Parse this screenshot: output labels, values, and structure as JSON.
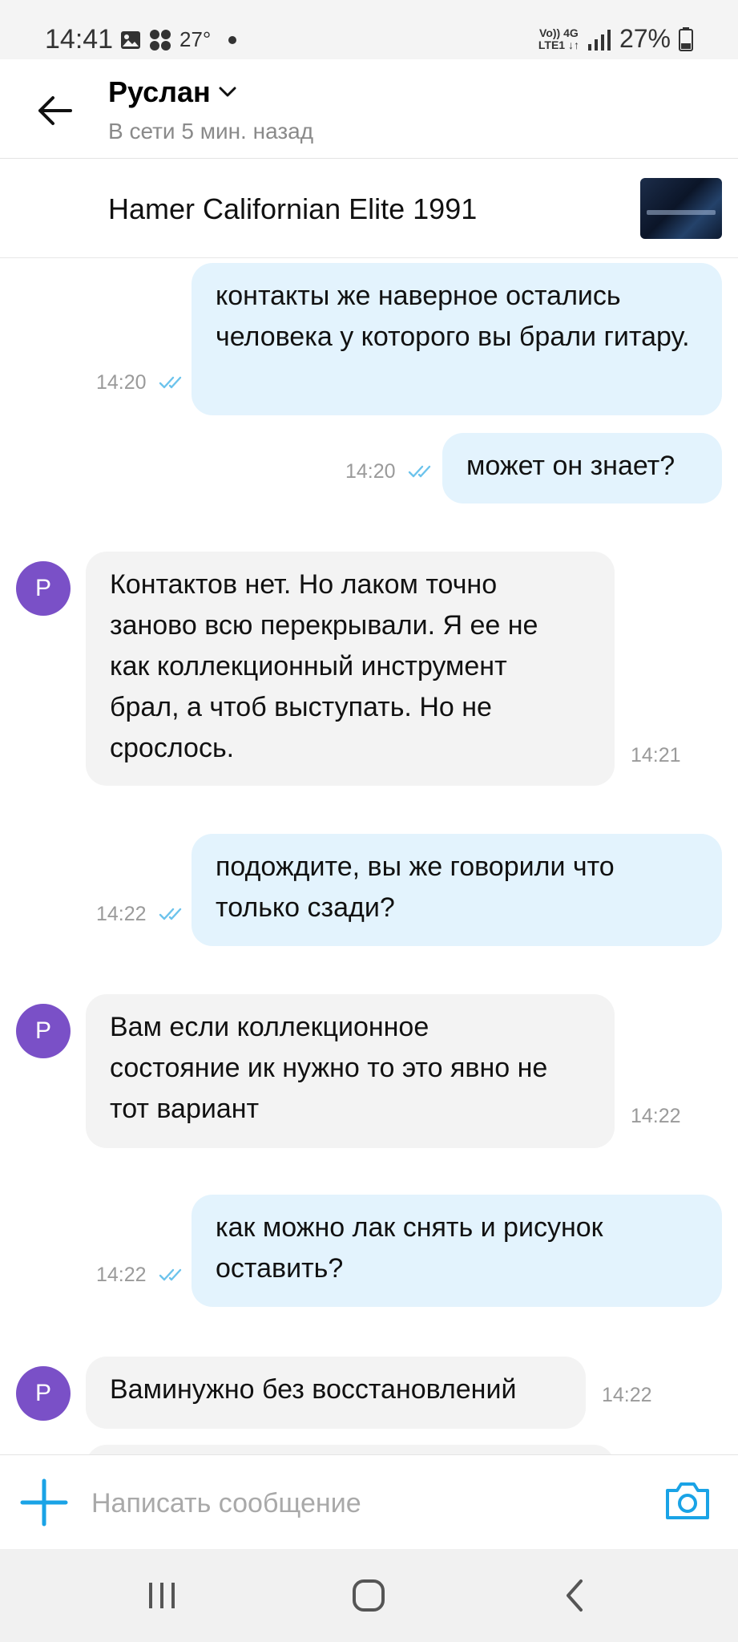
{
  "status_bar": {
    "time": "14:41",
    "temperature": "27°",
    "network_top": "Vo)) 4G",
    "network_bottom": "LTE1 ↓↑",
    "battery": "27%"
  },
  "header": {
    "contact_name": "Руслан",
    "status": "В сети 5 мин. назад"
  },
  "listing": {
    "title": "Hamer Californian Elite 1991"
  },
  "messages": [
    {
      "direction": "out",
      "text": "контакты же наверное остались человека у которого вы брали гитару.",
      "time": "14:20",
      "read": true
    },
    {
      "direction": "out",
      "text": "может он знает?",
      "time": "14:20",
      "read": true
    },
    {
      "direction": "in",
      "avatar_letter": "Р",
      "text": "Контактов нет. Но лаком точно заново всю перекрывали. Я ее не как коллекционный инструмент брал, а чтоб выступать. Но не срослось.",
      "time": "14:21"
    },
    {
      "direction": "out",
      "text": "подождите, вы же говорили что только сзади?",
      "time": "14:22",
      "read": true
    },
    {
      "direction": "in",
      "avatar_letter": "Р",
      "text": "Вам если коллекционное состояние ик нужно то это явно не тот вариант",
      "time": "14:22"
    },
    {
      "direction": "out",
      "text": "как можно лак снять и рисунок оставить?",
      "time": "14:22",
      "read": true
    },
    {
      "direction": "in",
      "avatar_letter": "Р",
      "text": "Ваминужно без восстановлений",
      "time": "14:22"
    }
  ],
  "composer": {
    "placeholder": "Написать сообщение"
  },
  "colors": {
    "outgoing_bubble": "#e3f3fd",
    "incoming_bubble": "#f3f3f3",
    "accent": "#1aa3e6",
    "avatar": "#7a50c7",
    "read_ticks": "#6cc3ec"
  },
  "icons": {
    "back": "arrow-left-icon",
    "dropdown": "chevron-down-icon",
    "add": "plus-icon",
    "camera": "camera-icon",
    "nav_recents": "recents-icon",
    "nav_home": "home-icon",
    "nav_back": "nav-back-icon"
  }
}
